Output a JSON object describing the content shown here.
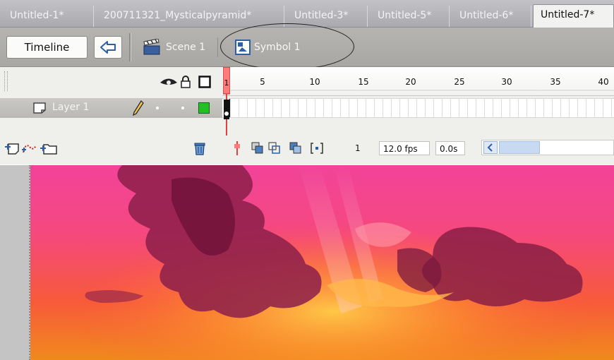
{
  "document_tabs": [
    {
      "label": "Untitled-1*",
      "active": false
    },
    {
      "label": "200711321_Mysticalpyramid*",
      "active": false
    },
    {
      "label": "Untitled-3*",
      "active": false
    },
    {
      "label": "Untitled-5*",
      "active": false
    },
    {
      "label": "Untitled-6*",
      "active": false
    },
    {
      "label": "Untitled-7*",
      "active": true
    }
  ],
  "navbar": {
    "timeline_label": "Timeline",
    "scene_label": "Scene 1",
    "symbol_label": "Symbol 1"
  },
  "timeline": {
    "ruler_ticks": [
      "1",
      "5",
      "10",
      "15",
      "20",
      "25",
      "30",
      "35",
      "40"
    ],
    "layer_name": "Layer 1",
    "current_frame": "1",
    "frame_rate": "12.0 fps",
    "elapsed_time": "0.0s"
  },
  "colors": {
    "tab_bar": "#b4b4b8",
    "navbar": "#afaeaa",
    "panel": "#efefec",
    "playhead": "#e04040",
    "layer_outline_color": "#22c022"
  }
}
